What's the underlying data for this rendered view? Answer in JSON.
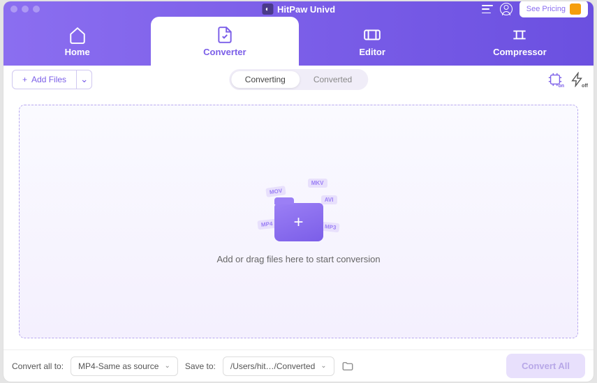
{
  "app_title": "HitPaw Univd",
  "titlebar": {
    "pricing_label": "See Pricing"
  },
  "nav": {
    "items": [
      {
        "label": "Home"
      },
      {
        "label": "Converter"
      },
      {
        "label": "Editor"
      },
      {
        "label": "Compressor"
      }
    ]
  },
  "toolbar": {
    "add_label": "Add Files",
    "tabs": {
      "converting": "Converting",
      "converted": "Converted"
    },
    "hw_label": "on",
    "speed_label": "off"
  },
  "dropzone": {
    "text": "Add or drag files here to start conversion",
    "chips": {
      "mov": "MOV",
      "mkv": "MKV",
      "avi": "AVI",
      "mp4": "MP4",
      "mp3": "MP3"
    }
  },
  "footer": {
    "convert_all_label": "Convert all to:",
    "format_value": "MP4-Same as source",
    "save_label": "Save to:",
    "save_value": "/Users/hit…/Converted",
    "convert_btn": "Convert All"
  }
}
